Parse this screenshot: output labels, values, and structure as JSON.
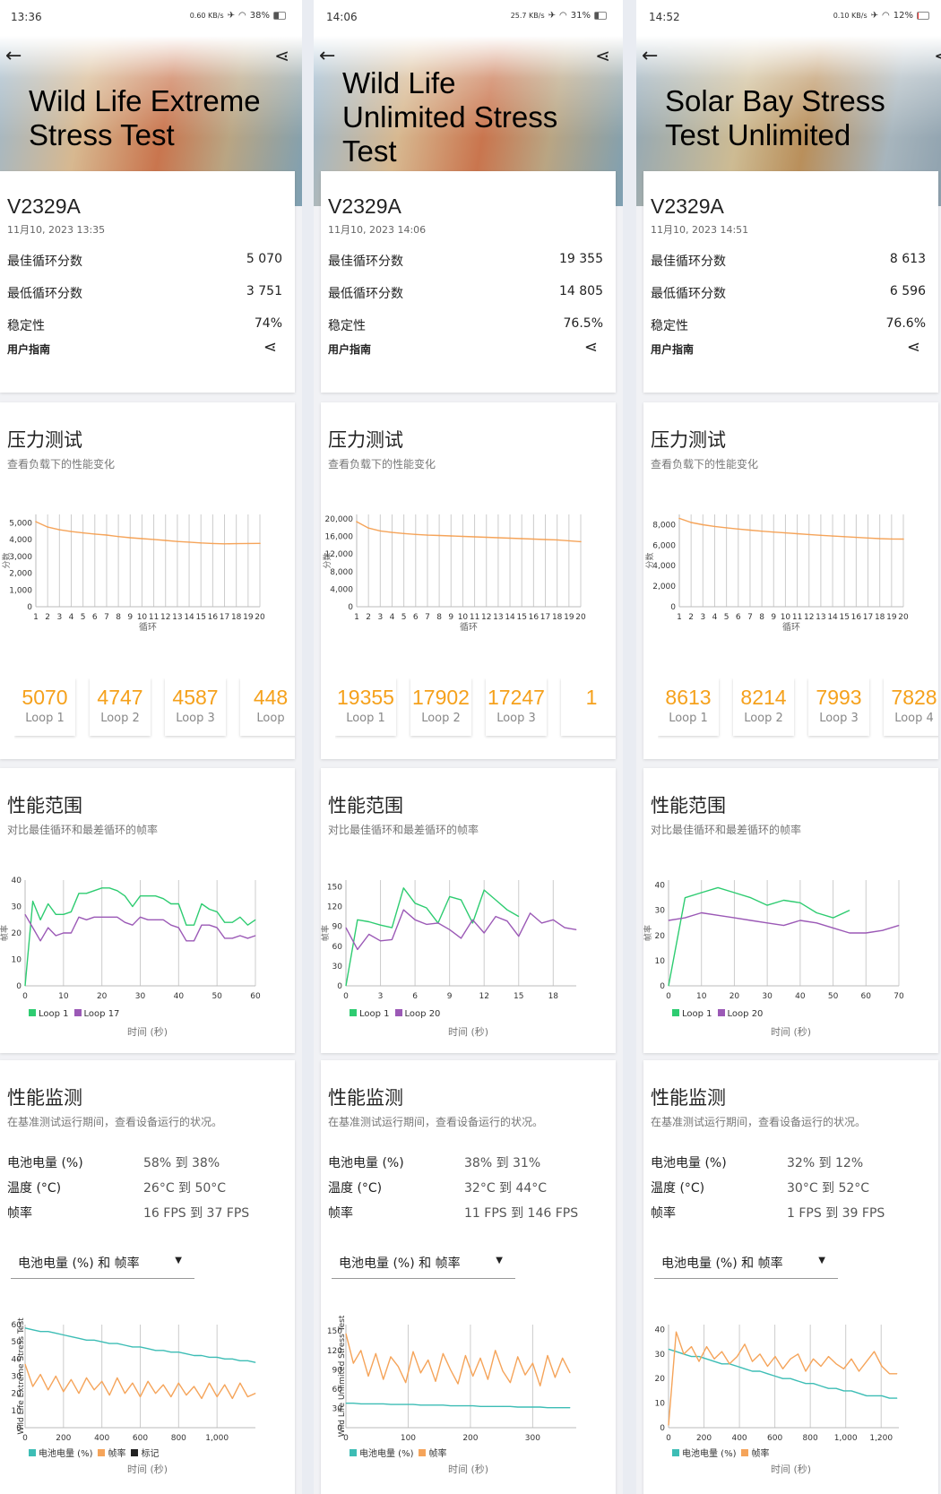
{
  "columns": [
    {
      "status": {
        "time": "13:36",
        "net": "0.60 KB/s",
        "battery": "38%",
        "battery_level": 0.38
      },
      "title": "Wild Life Extreme Stress Test",
      "device": "V2329A",
      "date": "11月10, 2023 13:35",
      "stats": [
        {
          "label": "最佳循环分数",
          "value": "5 070"
        },
        {
          "label": "最低循环分数",
          "value": "3 751"
        },
        {
          "label": "稳定性",
          "value": "74%"
        }
      ],
      "guide": "用户指南",
      "stress": {
        "title": "压力测试",
        "subtitle": "查看负载下的性能变化",
        "chart": 0
      },
      "loops": [
        {
          "score": "5070",
          "label": "Loop 1"
        },
        {
          "score": "4747",
          "label": "Loop 2"
        },
        {
          "score": "4587",
          "label": "Loop 3"
        },
        {
          "score": "448",
          "label": "Loop"
        }
      ],
      "range": {
        "title": "性能范围",
        "subtitle": "对比最佳循环和最差循环的帧率",
        "chart": 1
      },
      "monitor": {
        "title": "性能监测",
        "subtitle": "在基准测试运行期间，查看设备运行的状况。",
        "rows": [
          {
            "label": "电池电量 (%)",
            "value": "58% 到 38%"
          },
          {
            "label": "温度 (°C)",
            "value": "26°C 到 50°C"
          },
          {
            "label": "帧率",
            "value": "16 FPS 到 37 FPS"
          }
        ],
        "dropdown": "电池电量 (%) 和 帧率",
        "chart": 2
      }
    },
    {
      "status": {
        "time": "14:06",
        "net": "25.7 KB/s",
        "battery": "31%",
        "battery_level": 0.31
      },
      "title": "Wild Life Unlimited Stress Test",
      "device": "V2329A",
      "date": "11月10, 2023 14:06",
      "stats": [
        {
          "label": "最佳循环分数",
          "value": "19 355"
        },
        {
          "label": "最低循环分数",
          "value": "14 805"
        },
        {
          "label": "稳定性",
          "value": "76.5%"
        }
      ],
      "guide": "用户指南",
      "stress": {
        "title": "压力测试",
        "subtitle": "查看负载下的性能变化",
        "chart": 3
      },
      "loops": [
        {
          "score": "19355",
          "label": "Loop 1"
        },
        {
          "score": "17902",
          "label": "Loop 2"
        },
        {
          "score": "17247",
          "label": "Loop 3"
        },
        {
          "score": "1",
          "label": ""
        }
      ],
      "range": {
        "title": "性能范围",
        "subtitle": "对比最佳循环和最差循环的帧率",
        "chart": 4
      },
      "monitor": {
        "title": "性能监测",
        "subtitle": "在基准测试运行期间，查看设备运行的状况。",
        "rows": [
          {
            "label": "电池电量 (%)",
            "value": "38% 到 31%"
          },
          {
            "label": "温度 (°C)",
            "value": "32°C 到 44°C"
          },
          {
            "label": "帧率",
            "value": "11 FPS 到 146 FPS"
          }
        ],
        "dropdown": "电池电量 (%) 和 帧率",
        "chart": 5
      }
    },
    {
      "status": {
        "time": "14:52",
        "net": "0.10 KB/s",
        "battery": "12%",
        "battery_level": 0.12
      },
      "title": "Solar Bay Stress Test Unlimited",
      "device": "V2329A",
      "date": "11月10, 2023 14:51",
      "stats": [
        {
          "label": "最佳循环分数",
          "value": "8 613"
        },
        {
          "label": "最低循环分数",
          "value": "6 596"
        },
        {
          "label": "稳定性",
          "value": "76.6%"
        }
      ],
      "guide": "用户指南",
      "stress": {
        "title": "压力测试",
        "subtitle": "查看负载下的性能变化",
        "chart": 6
      },
      "loops": [
        {
          "score": "8613",
          "label": "Loop 1"
        },
        {
          "score": "8214",
          "label": "Loop 2"
        },
        {
          "score": "7993",
          "label": "Loop 3"
        },
        {
          "score": "7828",
          "label": "Loop 4"
        }
      ],
      "range": {
        "title": "性能范围",
        "subtitle": "对比最佳循环和最差循环的帧率",
        "chart": 7
      },
      "monitor": {
        "title": "性能监测",
        "subtitle": "在基准测试运行期间，查看设备运行的状况。",
        "rows": [
          {
            "label": "电池电量 (%)",
            "value": "32% 到 12%"
          },
          {
            "label": "温度 (°C)",
            "value": "30°C 到 52°C"
          },
          {
            "label": "帧率",
            "value": "1 FPS 到 39 FPS"
          }
        ],
        "dropdown": "电池电量 (%) 和 帧率",
        "chart": 8
      }
    }
  ],
  "colors": {
    "score": "#f5a45a",
    "loop_best": "#2ecc71",
    "loop_worst": "#9b59b6",
    "battery": "#3dbdb5",
    "fps": "#f5a45a",
    "marker": "#222222",
    "accent": "#f5a11c"
  },
  "chart_data": [
    {
      "type": "line",
      "xlabel": "循环",
      "ylabel": "分数",
      "ylim": [
        0,
        5500
      ],
      "yticks": [
        0,
        1000,
        2000,
        3000,
        4000,
        5000
      ],
      "ytick_labels": [
        "0",
        "1,000",
        "2,000",
        "3,000",
        "4,000",
        "5,000"
      ],
      "categories": [
        1,
        2,
        3,
        4,
        5,
        6,
        7,
        8,
        9,
        10,
        11,
        12,
        13,
        14,
        15,
        16,
        17,
        18,
        19,
        20
      ],
      "series": [
        {
          "name": "score",
          "values": [
            5070,
            4747,
            4587,
            4480,
            4400,
            4330,
            4270,
            4180,
            4110,
            4060,
            4010,
            3950,
            3890,
            3850,
            3800,
            3770,
            3751,
            3760,
            3770,
            3775
          ]
        }
      ]
    },
    {
      "type": "line",
      "xlabel": "时间 (秒)",
      "ylabel": "帧率",
      "xlim": [
        0,
        60
      ],
      "xticks": [
        0,
        10,
        20,
        30,
        40,
        50,
        60
      ],
      "ylim": [
        0,
        40
      ],
      "yticks": [
        0,
        10,
        20,
        30,
        40
      ],
      "series": [
        {
          "name": "Loop 1",
          "xstep": 2,
          "values": [
            0,
            32,
            25,
            31,
            27,
            27,
            28,
            35,
            35,
            36,
            37,
            37,
            36,
            34,
            30,
            34,
            34,
            34,
            33,
            31,
            31,
            23,
            23,
            31,
            29,
            28,
            24,
            24,
            26,
            23,
            25
          ]
        },
        {
          "name": "Loop 17",
          "xstep": 2,
          "values": [
            27,
            22,
            17,
            22,
            19,
            20,
            20,
            26,
            25,
            26,
            26,
            26,
            26,
            24,
            23,
            26,
            25,
            25,
            25,
            23,
            22,
            17,
            17,
            23,
            23,
            22,
            18,
            18,
            19,
            18,
            19
          ]
        }
      ]
    },
    {
      "type": "line",
      "xlabel": "时间 (秒)",
      "ylabel": "Wild Life Extreme Stress Test",
      "xlim": [
        0,
        1200
      ],
      "xticks": [
        0,
        200,
        400,
        600,
        800,
        1000
      ],
      "xtick_labels": [
        "0",
        "200",
        "400",
        "600",
        "800",
        "1,000"
      ],
      "ylim": [
        0,
        60
      ],
      "yticks": [
        0,
        10,
        20,
        30,
        40,
        50,
        60
      ],
      "legend": [
        "电池电量 (%)",
        "帧率",
        "标记"
      ],
      "series": [
        {
          "name": "电池电量 (%)",
          "xstep": 40,
          "values": [
            58,
            57,
            56,
            56,
            55,
            54,
            53,
            52,
            51,
            51,
            50,
            49,
            49,
            48,
            47,
            47,
            46,
            45,
            45,
            44,
            44,
            43,
            42,
            42,
            41,
            41,
            40,
            40,
            39,
            39,
            38
          ]
        },
        {
          "name": "帧率",
          "xstep": 40,
          "values": [
            37,
            24,
            31,
            22,
            30,
            21,
            28,
            20,
            29,
            22,
            27,
            19,
            29,
            20,
            26,
            18,
            27,
            20,
            25,
            18,
            26,
            19,
            24,
            17,
            26,
            18,
            25,
            17,
            26,
            18,
            20
          ]
        }
      ]
    },
    {
      "type": "line",
      "xlabel": "循环",
      "ylabel": "分数",
      "ylim": [
        0,
        21000
      ],
      "yticks": [
        0,
        4000,
        8000,
        12000,
        16000,
        20000
      ],
      "ytick_labels": [
        "0",
        "4,000",
        "8,000",
        "12,000",
        "16,000",
        "20,000"
      ],
      "categories": [
        1,
        2,
        3,
        4,
        5,
        6,
        7,
        8,
        9,
        10,
        11,
        12,
        13,
        14,
        15,
        16,
        17,
        18,
        19,
        20
      ],
      "series": [
        {
          "name": "score",
          "values": [
            19355,
            17902,
            17247,
            16900,
            16650,
            16450,
            16300,
            16200,
            16100,
            16000,
            15900,
            15800,
            15700,
            15600,
            15500,
            15400,
            15300,
            15200,
            15000,
            14805
          ]
        }
      ]
    },
    {
      "type": "line",
      "xlabel": "时间 (秒)",
      "ylabel": "帧率",
      "xlim": [
        0,
        20
      ],
      "xticks": [
        0,
        3,
        6,
        9,
        12,
        15,
        18
      ],
      "ylim": [
        0,
        160
      ],
      "yticks": [
        0,
        30,
        60,
        90,
        120,
        150
      ],
      "series": [
        {
          "name": "Loop 1",
          "xstep": 1,
          "values": [
            0,
            100,
            97,
            92,
            88,
            148,
            125,
            118,
            95,
            135,
            130,
            95,
            145,
            130,
            115,
            105
          ]
        },
        {
          "name": "Loop 20",
          "xstep": 1,
          "values": [
            88,
            55,
            78,
            68,
            70,
            115,
            100,
            93,
            95,
            85,
            72,
            100,
            80,
            105,
            98,
            75,
            110,
            95,
            100,
            88,
            85
          ]
        }
      ]
    },
    {
      "type": "line",
      "xlabel": "时间 (秒)",
      "ylabel": "Wild Life Unlimited Stress Test",
      "xlim": [
        0,
        370
      ],
      "xticks": [
        0,
        100,
        200,
        300
      ],
      "ylim": [
        0,
        160
      ],
      "yticks": [
        0,
        30,
        60,
        90,
        120,
        150
      ],
      "legend": [
        "电池电量 (%)",
        "帧率"
      ],
      "series": [
        {
          "name": "电池电量 (%)",
          "xstep": 12,
          "values": [
            38,
            38,
            37,
            37,
            37,
            37,
            36,
            36,
            36,
            36,
            35,
            35,
            35,
            35,
            34,
            34,
            34,
            34,
            33,
            33,
            33,
            33,
            33,
            32,
            32,
            32,
            32,
            31,
            31,
            31,
            31
          ]
        },
        {
          "name": "帧率",
          "xstep": 12,
          "values": [
            146,
            100,
            120,
            80,
            115,
            75,
            110,
            95,
            70,
            118,
            85,
            105,
            72,
            115,
            90,
            68,
            112,
            80,
            108,
            75,
            120,
            88,
            70,
            110,
            82,
            100,
            65,
            112,
            78,
            108,
            85
          ]
        }
      ]
    },
    {
      "type": "line",
      "xlabel": "循环",
      "ylabel": "分数",
      "ylim": [
        0,
        9000
      ],
      "yticks": [
        0,
        2000,
        4000,
        6000,
        8000
      ],
      "ytick_labels": [
        "0",
        "2,000",
        "4,000",
        "6,000",
        "8,000"
      ],
      "categories": [
        1,
        2,
        3,
        4,
        5,
        6,
        7,
        8,
        9,
        10,
        11,
        12,
        13,
        14,
        15,
        16,
        17,
        18,
        19,
        20
      ],
      "series": [
        {
          "name": "score",
          "values": [
            8613,
            8214,
            7993,
            7828,
            7700,
            7580,
            7470,
            7370,
            7280,
            7200,
            7120,
            7040,
            6960,
            6890,
            6830,
            6760,
            6700,
            6640,
            6610,
            6596
          ]
        }
      ]
    },
    {
      "type": "line",
      "xlabel": "时间 (秒)",
      "ylabel": "帧率",
      "xlim": [
        0,
        70
      ],
      "xticks": [
        0,
        10,
        20,
        30,
        40,
        50,
        60,
        70
      ],
      "ylim": [
        0,
        42
      ],
      "yticks": [
        0,
        10,
        20,
        30,
        40
      ],
      "series": [
        {
          "name": "Loop 1",
          "xstep": 5,
          "values": [
            0,
            35,
            37,
            39,
            37,
            35,
            32,
            34,
            33,
            29,
            27,
            30
          ]
        },
        {
          "name": "Loop 20",
          "xstep": 5,
          "values": [
            26,
            27,
            29,
            28,
            27,
            26,
            25,
            24,
            26,
            25,
            23,
            21,
            21,
            22,
            24
          ]
        }
      ]
    },
    {
      "type": "line",
      "xlabel": "时间 (秒)",
      "ylabel": "",
      "xlim": [
        0,
        1300
      ],
      "xticks": [
        0,
        200,
        400,
        600,
        800,
        1000,
        1200
      ],
      "xtick_labels": [
        "0",
        "200",
        "400",
        "600",
        "800",
        "1,000",
        "1,200"
      ],
      "ylim": [
        0,
        42
      ],
      "yticks": [
        0,
        10,
        20,
        30,
        40
      ],
      "legend": [
        "电池电量 (%)",
        "帧率"
      ],
      "series": [
        {
          "name": "电池电量 (%)",
          "xstep": 43,
          "values": [
            32,
            31,
            30,
            29,
            29,
            28,
            27,
            26,
            26,
            25,
            24,
            23,
            23,
            22,
            21,
            20,
            20,
            19,
            18,
            18,
            17,
            16,
            16,
            15,
            15,
            14,
            13,
            13,
            13,
            12,
            12
          ]
        },
        {
          "name": "帧率",
          "xstep": 43,
          "values": [
            1,
            39,
            30,
            33,
            27,
            33,
            28,
            31,
            26,
            29,
            34,
            27,
            30,
            25,
            29,
            24,
            28,
            30,
            23,
            28,
            25,
            29,
            26,
            24,
            28,
            23,
            27,
            31,
            25,
            22,
            22
          ]
        }
      ]
    }
  ]
}
